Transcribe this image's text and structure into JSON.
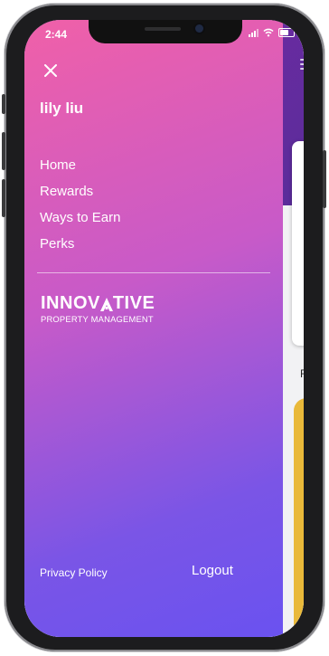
{
  "status_bar": {
    "time": "2:44"
  },
  "drawer": {
    "user_name": "lily liu",
    "menu": [
      {
        "label": "Home"
      },
      {
        "label": "Rewards"
      },
      {
        "label": "Ways to Earn"
      },
      {
        "label": "Perks"
      }
    ],
    "logo": {
      "line1_a": "INNOV",
      "line1_b": "TIVE",
      "line2": "PROPERTY MANAGEMENT"
    },
    "privacy_label": "Privacy Policy",
    "logout_label": "Logout"
  },
  "background_app": {
    "partial_text": "R"
  },
  "colors": {
    "drawer_gradient_start": "#f060a8",
    "drawer_gradient_end": "#6a52f0",
    "app_header": "#5a2c9a",
    "app_card_accent": "#e9b93a"
  }
}
